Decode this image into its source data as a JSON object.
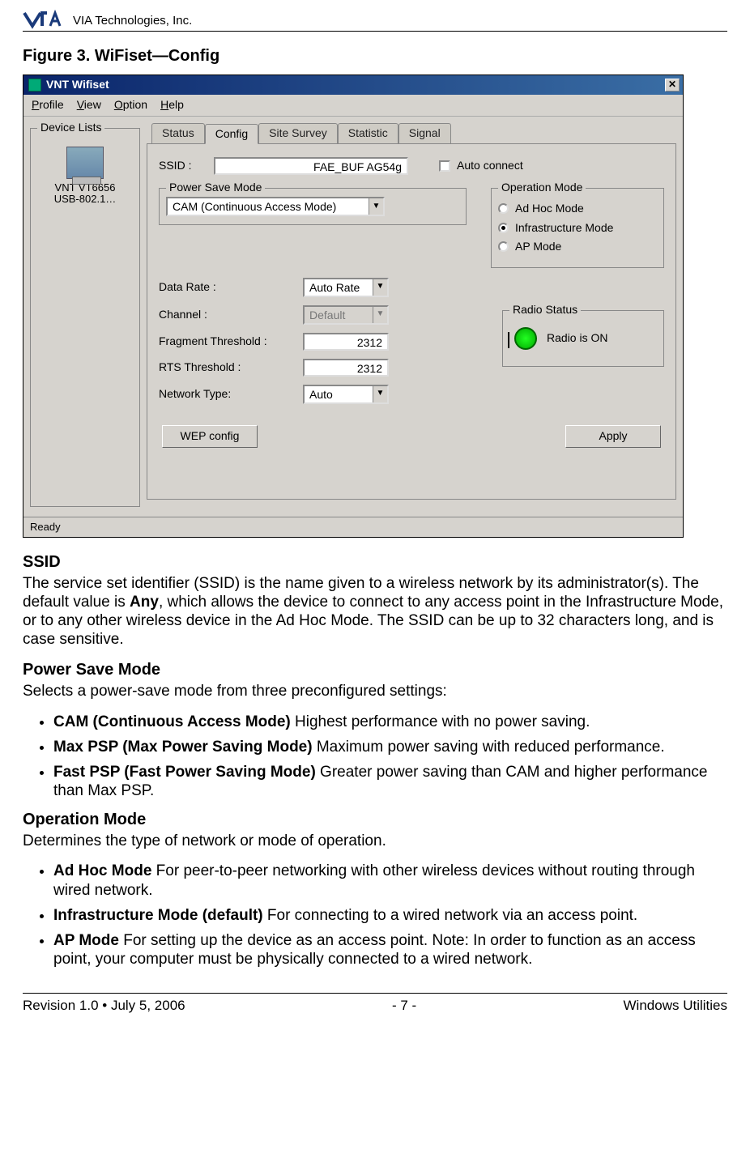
{
  "header": {
    "company": "VIA Technologies, Inc."
  },
  "figure_title": "Figure 3. WiFiset—Config",
  "app": {
    "title": "VNT Wifiset",
    "menus": {
      "profile": "Profile",
      "view": "View",
      "option": "Option",
      "help": "Help"
    },
    "device_lists_legend": "Device Lists",
    "device": {
      "line1": "VNT VT6656",
      "line2": "USB-802.1…"
    },
    "tabs": {
      "status": "Status",
      "config": "Config",
      "site_survey": "Site Survey",
      "statistic": "Statistic",
      "signal": "Signal"
    },
    "config": {
      "ssid_label": "SSID :",
      "ssid_value": "FAE_BUF AG54g",
      "auto_connect": "Auto connect",
      "power_save_legend": "Power Save Mode",
      "power_save_value": "CAM (Continuous Access Mode)",
      "op_mode_legend": "Operation Mode",
      "op_mode": {
        "adhoc": "Ad Hoc Mode",
        "infra": "Infrastructure Mode",
        "ap": "AP Mode"
      },
      "data_rate_label": "Data Rate :",
      "data_rate_value": "Auto Rate",
      "channel_label": "Channel :",
      "channel_value": "Default",
      "frag_label": "Fragment Threshold :",
      "frag_value": "2312",
      "rts_label": "RTS Threshold :",
      "rts_value": "2312",
      "net_type_label": "Network Type:",
      "net_type_value": "Auto",
      "radio_status_legend": "Radio Status",
      "radio_status_text": "Radio is ON",
      "wep_btn": "WEP config",
      "apply_btn": "Apply"
    },
    "statusbar": "Ready"
  },
  "sections": {
    "ssid": {
      "title": "SSID",
      "p1_a": "The service set identifier (SSID) is the name given to a wireless network by its administrator(s). The default value is ",
      "p1_b": "Any",
      "p1_c": ", which allows the device to connect to any access point in the Infrastructure Mode, or to any other wireless device in the Ad Hoc Mode. The SSID can be up to 32 characters long, and is case sensitive."
    },
    "psm": {
      "title": "Power Save Mode",
      "desc": "Selects a power-save mode from three preconfigured settings:",
      "items": [
        {
          "b": "CAM (Continuous Access Mode)",
          "t": "   Highest performance with no power saving."
        },
        {
          "b": "Max PSP (Max Power Saving Mode)",
          "t": "   Maximum power saving with reduced performance."
        },
        {
          "b": "Fast PSP (Fast Power Saving Mode)",
          "t": "   Greater power saving than CAM and higher performance than Max PSP."
        }
      ]
    },
    "om": {
      "title": "Operation Mode",
      "desc": "Determines the type of network or mode of operation.",
      "items": [
        {
          "b": "Ad Hoc Mode",
          "t": "   For peer-to-peer networking with other wireless devices without routing through wired network."
        },
        {
          "b": "Infrastructure Mode (default)",
          "t": "   For connecting to a wired network via an access point."
        },
        {
          "b": "AP Mode",
          "t": "   For setting up the device as an access point. Note: In order to function as an access point, your computer must be physically connected to a wired network."
        }
      ]
    }
  },
  "footer": {
    "left": "Revision 1.0 • July 5, 2006",
    "center": "- 7 -",
    "right": "Windows Utilities"
  }
}
